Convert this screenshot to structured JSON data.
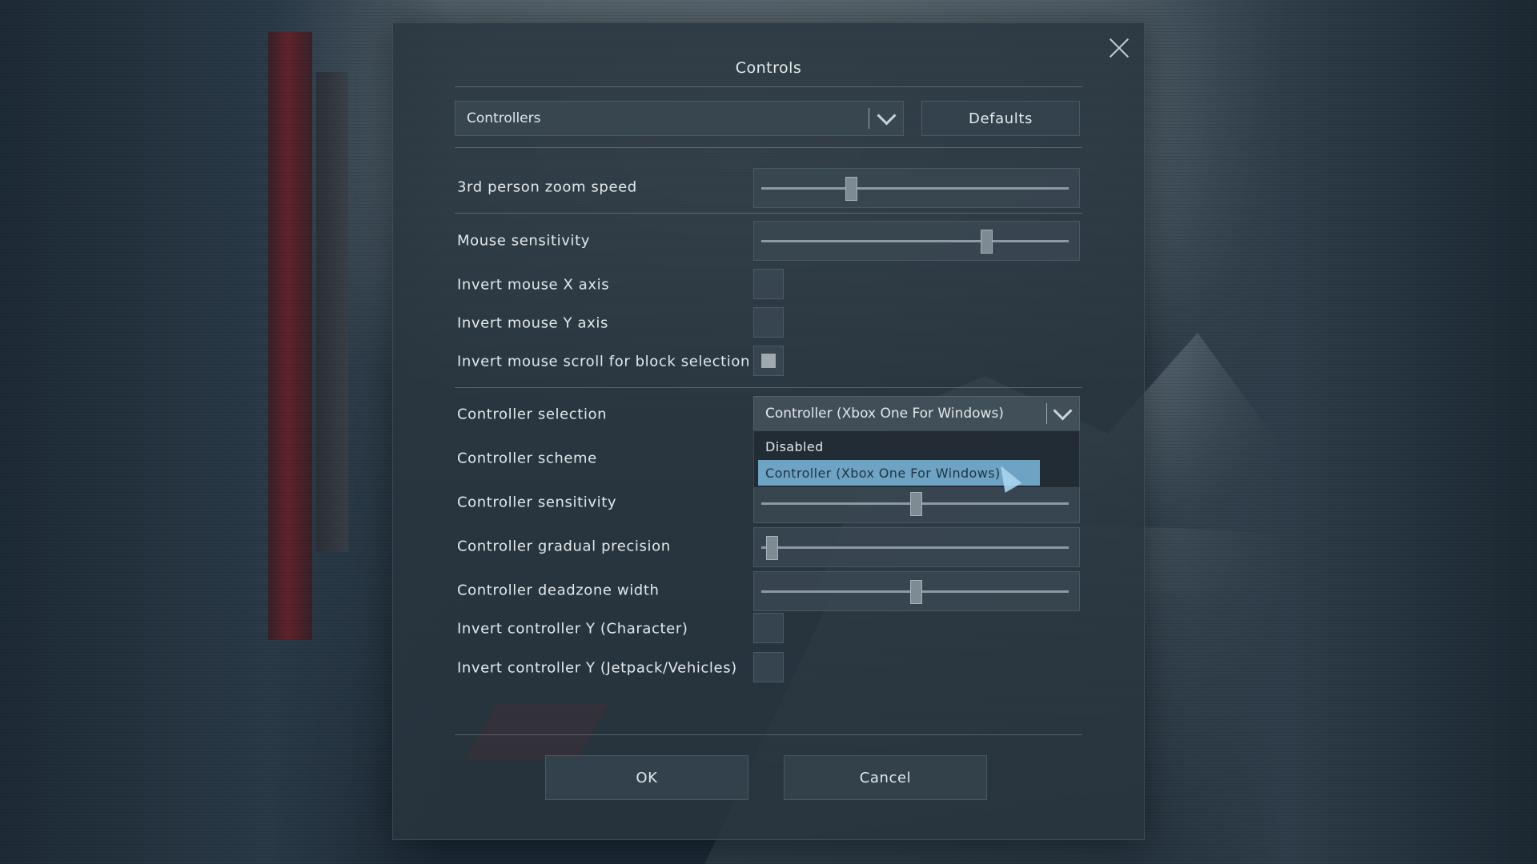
{
  "dialog": {
    "title": "Controls",
    "category_value": "Controllers",
    "defaults_label": "Defaults",
    "ok_label": "OK",
    "cancel_label": "Cancel"
  },
  "settings": {
    "zoom_speed": {
      "label": "3rd person zoom speed",
      "value": 0.29
    },
    "mouse_sensitivity": {
      "label": "Mouse sensitivity",
      "value": 0.73
    },
    "invert_mouse_x": {
      "label": "Invert mouse X axis",
      "checked": false
    },
    "invert_mouse_y": {
      "label": "Invert mouse Y axis",
      "checked": false
    },
    "invert_scroll": {
      "label": "Invert mouse scroll for block selection",
      "checked": true
    },
    "controller_selection": {
      "label": "Controller selection",
      "value": "Controller (Xbox One For Windows)",
      "options": [
        "Disabled",
        "Controller (Xbox One For Windows)"
      ],
      "highlighted_option": "Controller (Xbox One For Windows)"
    },
    "controller_scheme": {
      "label": "Controller scheme"
    },
    "controller_sensitivity": {
      "label": "Controller sensitivity",
      "value": 0.5
    },
    "controller_gradual_precision": {
      "label": "Controller gradual precision",
      "value": 0.03
    },
    "controller_deadzone": {
      "label": "Controller deadzone width",
      "value": 0.5
    },
    "invert_controller_y_character": {
      "label": "Invert controller Y (Character)",
      "checked": false
    },
    "invert_controller_y_jetpack": {
      "label": "Invert controller Y (Jetpack/Vehicles)",
      "checked": false
    }
  },
  "icons": {
    "close": "close-icon",
    "chevron": "chevron-down-icon",
    "cursor": "mouse-cursor-icon"
  }
}
